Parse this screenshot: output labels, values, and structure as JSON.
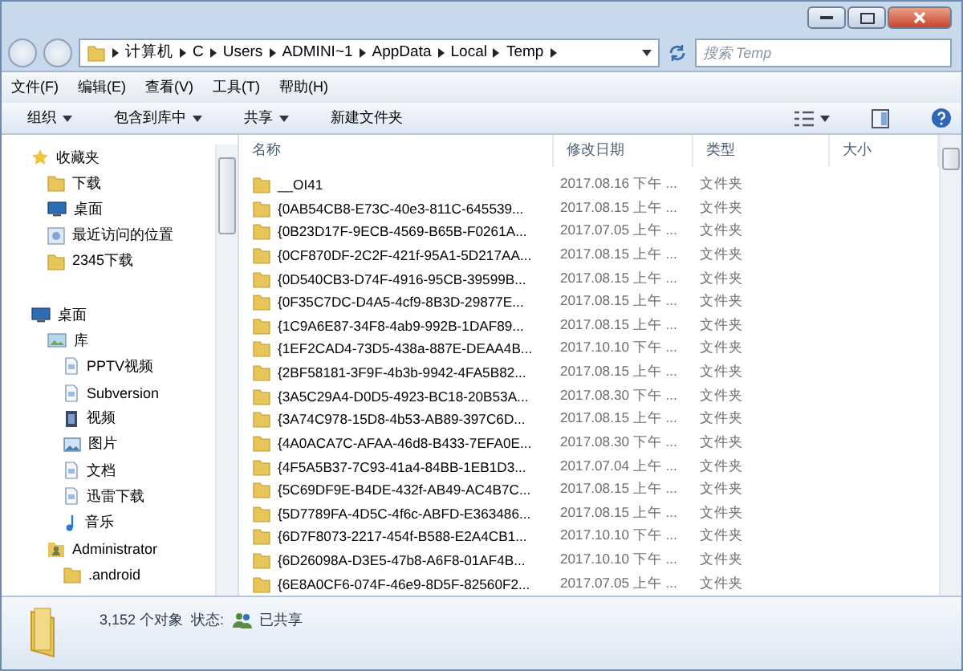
{
  "address_bar": {
    "crumbs": [
      "计算机",
      "C",
      "Users",
      "ADMINI~1",
      "AppData",
      "Local",
      "Temp"
    ]
  },
  "search": {
    "placeholder": "搜索 Temp"
  },
  "menu_bar": [
    "文件(F)",
    "编辑(E)",
    "查看(V)",
    "工具(T)",
    "帮助(H)"
  ],
  "toolbar": [
    {
      "label": "组织",
      "dropdown": true
    },
    {
      "label": "包含到库中",
      "dropdown": true
    },
    {
      "label": "共享",
      "dropdown": true
    },
    {
      "label": "新建文件夹",
      "dropdown": false
    }
  ],
  "sidebar": {
    "items": [
      {
        "label": "收藏夹",
        "kind": "star",
        "children": [
          {
            "label": "下载",
            "kind": "folder"
          },
          {
            "label": "桌面",
            "kind": "desktop"
          },
          {
            "label": "最近访问的位置",
            "kind": "recent"
          },
          {
            "label": "2345下载",
            "kind": "folder"
          }
        ]
      },
      {
        "label": "桌面",
        "kind": "desktop",
        "children": [
          {
            "label": "库",
            "kind": "library",
            "children": [
              {
                "label": "PPTV视频",
                "kind": "doc"
              },
              {
                "label": "Subversion",
                "kind": "doc"
              },
              {
                "label": "视频",
                "kind": "video"
              },
              {
                "label": "图片",
                "kind": "picture"
              },
              {
                "label": "文档",
                "kind": "doc"
              },
              {
                "label": "迅雷下载",
                "kind": "doc"
              },
              {
                "label": "音乐",
                "kind": "music"
              }
            ]
          },
          {
            "label": "Administrator",
            "kind": "user",
            "children": [
              {
                "label": ".android",
                "kind": "folder"
              }
            ]
          }
        ]
      }
    ]
  },
  "table": {
    "columns": [
      "名称",
      "修改日期",
      "类型",
      "大小"
    ],
    "rows": [
      {
        "name": "__OI41",
        "date": "2017.08.16 下午 ...",
        "type": "文件夹"
      },
      {
        "name": "{0AB54CB8-E73C-40e3-811C-645539...",
        "date": "2017.08.15 上午 ...",
        "type": "文件夹"
      },
      {
        "name": "{0B23D17F-9ECB-4569-B65B-F0261A...",
        "date": "2017.07.05 上午 ...",
        "type": "文件夹"
      },
      {
        "name": "{0CF870DF-2C2F-421f-95A1-5D217AA...",
        "date": "2017.08.15 上午 ...",
        "type": "文件夹"
      },
      {
        "name": "{0D540CB3-D74F-4916-95CB-39599B...",
        "date": "2017.08.15 上午 ...",
        "type": "文件夹"
      },
      {
        "name": "{0F35C7DC-D4A5-4cf9-8B3D-29877E...",
        "date": "2017.08.15 上午 ...",
        "type": "文件夹"
      },
      {
        "name": "{1C9A6E87-34F8-4ab9-992B-1DAF89...",
        "date": "2017.08.15 上午 ...",
        "type": "文件夹"
      },
      {
        "name": "{1EF2CAD4-73D5-438a-887E-DEAA4B...",
        "date": "2017.10.10 下午 ...",
        "type": "文件夹"
      },
      {
        "name": "{2BF58181-3F9F-4b3b-9942-4FA5B82...",
        "date": "2017.08.15 上午 ...",
        "type": "文件夹"
      },
      {
        "name": "{3A5C29A4-D0D5-4923-BC18-20B53A...",
        "date": "2017.08.30 下午 ...",
        "type": "文件夹"
      },
      {
        "name": "{3A74C978-15D8-4b53-AB89-397C6D...",
        "date": "2017.08.15 上午 ...",
        "type": "文件夹"
      },
      {
        "name": "{4A0ACA7C-AFAA-46d8-B433-7EFA0E...",
        "date": "2017.08.30 下午 ...",
        "type": "文件夹"
      },
      {
        "name": "{4F5A5B37-7C93-41a4-84BB-1EB1D3...",
        "date": "2017.07.04 上午 ...",
        "type": "文件夹"
      },
      {
        "name": "{5C69DF9E-B4DE-432f-AB49-AC4B7C...",
        "date": "2017.08.15 上午 ...",
        "type": "文件夹"
      },
      {
        "name": "{5D7789FA-4D5C-4f6c-ABFD-E363486...",
        "date": "2017.08.15 上午 ...",
        "type": "文件夹"
      },
      {
        "name": "{6D7F8073-2217-454f-B588-E2A4CB1...",
        "date": "2017.10.10 下午 ...",
        "type": "文件夹"
      },
      {
        "name": "{6D26098A-D3E5-47b8-A6F8-01AF4B...",
        "date": "2017.10.10 下午 ...",
        "type": "文件夹"
      },
      {
        "name": "{6E8A0CF6-074F-46e9-8D5F-82560F2...",
        "date": "2017.07.05 上午 ...",
        "type": "文件夹"
      }
    ]
  },
  "status_bar": {
    "count": "3,152 个对象",
    "state_label": "状态:",
    "state": "已共享"
  }
}
